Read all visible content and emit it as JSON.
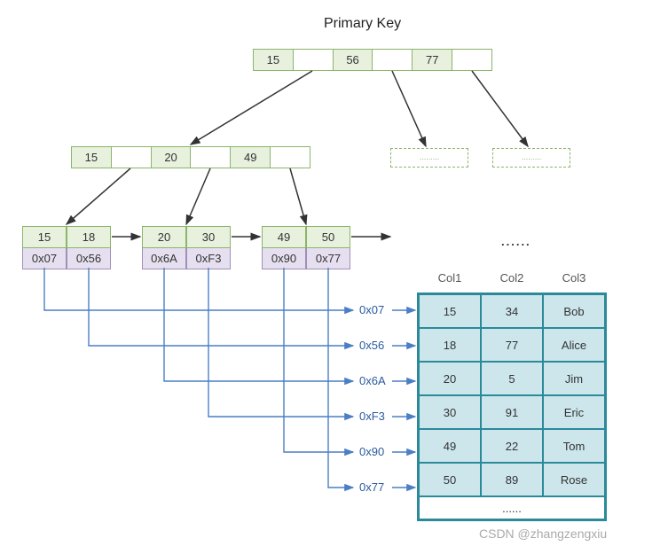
{
  "title": "Primary Key",
  "root": {
    "k0": "15",
    "k1": "56",
    "k2": "77"
  },
  "level1": {
    "k0": "15",
    "k1": "20",
    "k2": "49"
  },
  "leaves": [
    {
      "k0": "15",
      "k1": "18",
      "p0": "0x07",
      "p1": "0x56"
    },
    {
      "k0": "20",
      "k1": "30",
      "p0": "0x6A",
      "p1": "0xF3"
    },
    {
      "k0": "49",
      "k1": "50",
      "p0": "0x90",
      "p1": "0x77"
    }
  ],
  "pointers": [
    "0x07",
    "0x56",
    "0x6A",
    "0xF3",
    "0x90",
    "0x77"
  ],
  "columns": {
    "c1": "Col1",
    "c2": "Col2",
    "c3": "Col3"
  },
  "rows": [
    {
      "c1": "15",
      "c2": "34",
      "c3": "Bob"
    },
    {
      "c1": "18",
      "c2": "77",
      "c3": "Alice"
    },
    {
      "c1": "20",
      "c2": "5",
      "c3": "Jim"
    },
    {
      "c1": "30",
      "c2": "91",
      "c3": "Eric"
    },
    {
      "c1": "49",
      "c2": "22",
      "c3": "Tom"
    },
    {
      "c1": "50",
      "c2": "89",
      "c3": "Rose"
    }
  ],
  "ellipsis": "......",
  "watermark": "CSDN @zhangzengxiu"
}
